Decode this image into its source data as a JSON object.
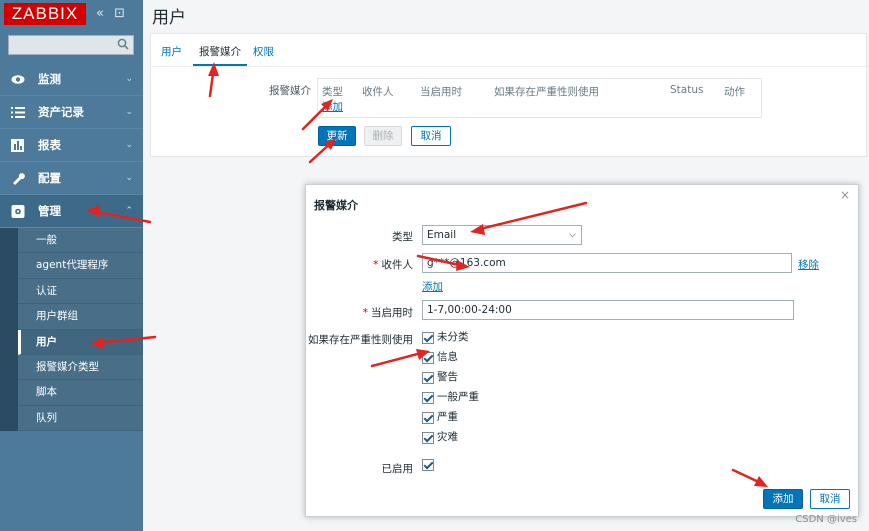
{
  "logo": {
    "text": "ZABBIX",
    "btn_collapse": "«",
    "btn_kiosk": "⊡"
  },
  "sidebar": {
    "search": {
      "value": "",
      "placeholder": ""
    },
    "items": [
      {
        "label": "监测",
        "icon": "eye-icon"
      },
      {
        "label": "资产记录",
        "icon": "list-icon"
      },
      {
        "label": "报表",
        "icon": "bar-chart-icon"
      },
      {
        "label": "配置",
        "icon": "wrench-icon"
      },
      {
        "label": "管理",
        "icon": "gear-icon"
      }
    ],
    "admin_sub": [
      "一般",
      "agent代理程序",
      "认证",
      "用户群组",
      "用户",
      "报警媒介类型",
      "脚本",
      "队列"
    ]
  },
  "page": {
    "title": "用户"
  },
  "tabs": [
    "用户",
    "报警媒介",
    "权限"
  ],
  "media": {
    "label": "报警媒介",
    "columns": [
      "类型",
      "收件人",
      "当启用时",
      "如果存在严重性则使用",
      "Status",
      "动作"
    ],
    "add_link": "添加"
  },
  "buttons": {
    "update": "更新",
    "delete": "删除",
    "cancel": "取消"
  },
  "dialog": {
    "title": "报警媒介",
    "close": "×",
    "type_label": "类型",
    "type_value": "Email",
    "sendto_label": "收件人",
    "sendto_value": "g***@163.com",
    "remove_link": "移除",
    "add_link": "添加",
    "when_label": "当启用时",
    "when_value": "1-7,00:00-24:00",
    "severity_label": "如果存在严重性则使用",
    "severities": [
      "未分类",
      "信息",
      "警告",
      "一般严重",
      "严重",
      "灾难"
    ],
    "enabled_label": "已启用",
    "add_button": "添加",
    "cancel_button": "取消"
  },
  "watermark": "CSDN @ives"
}
